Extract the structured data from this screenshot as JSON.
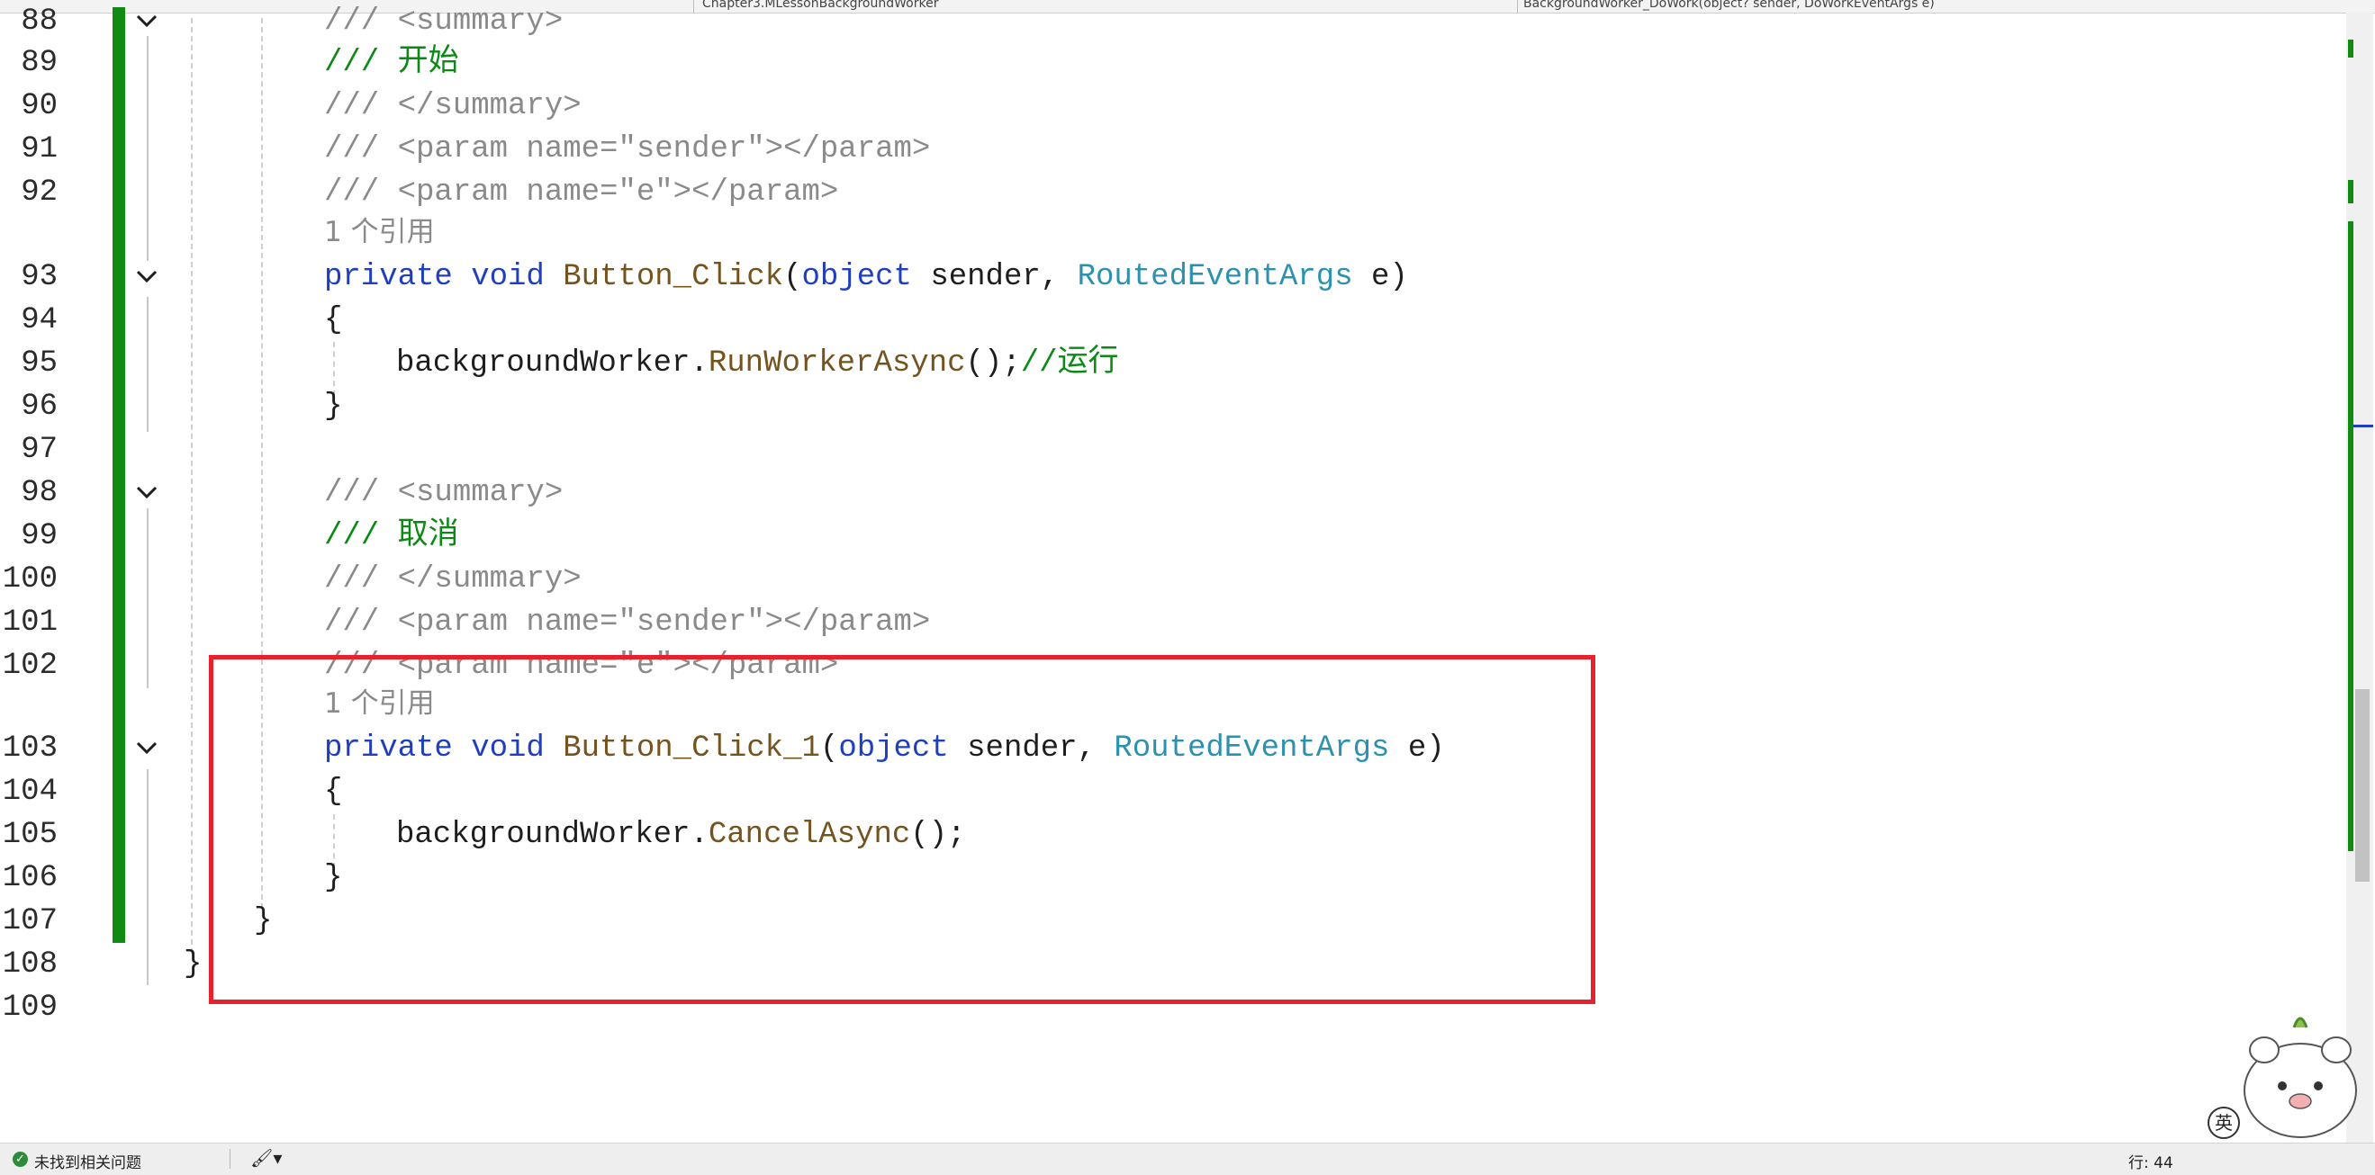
{
  "tabs": {
    "nav_left": "Chapter3.MLessonBackgroundWorker",
    "nav_right": "BackgroundWorker_DoWork(object? sender, DoWorkEventArgs e)"
  },
  "editor": {
    "lines": [
      {
        "ln": "88",
        "code": "/// <summary>"
      },
      {
        "ln": "89",
        "code": "/// 开始"
      },
      {
        "ln": "90",
        "code": "/// </summary>"
      },
      {
        "ln": "91",
        "code": "/// <param name=\"sender\"></param>"
      },
      {
        "ln": "92",
        "code": "/// <param name=\"e\"></param>"
      },
      {
        "ln": "",
        "code": "1 个引用"
      },
      {
        "ln": "93",
        "code": "private void Button_Click(object sender, RoutedEventArgs e)"
      },
      {
        "ln": "94",
        "code": "{"
      },
      {
        "ln": "95",
        "code": "backgroundWorker.RunWorkerAsync();//运行"
      },
      {
        "ln": "96",
        "code": "}"
      },
      {
        "ln": "97",
        "code": ""
      },
      {
        "ln": "98",
        "code": "/// <summary>"
      },
      {
        "ln": "99",
        "code": "/// 取消"
      },
      {
        "ln": "100",
        "code": "/// </summary>"
      },
      {
        "ln": "101",
        "code": "/// <param name=\"sender\"></param>"
      },
      {
        "ln": "102",
        "code": "/// <param name=\"e\"></param>"
      },
      {
        "ln": "",
        "code": "1 个引用"
      },
      {
        "ln": "103",
        "code": "private void Button_Click_1(object sender, RoutedEventArgs e)"
      },
      {
        "ln": "104",
        "code": "{"
      },
      {
        "ln": "105",
        "code": "backgroundWorker.CancelAsync();"
      },
      {
        "ln": "106",
        "code": "}"
      },
      {
        "ln": "107",
        "code": "}"
      },
      {
        "ln": "108",
        "code": "}"
      },
      {
        "ln": "109",
        "code": ""
      }
    ]
  },
  "status": {
    "message": "未找到相关问题",
    "position": "行: 44"
  },
  "ime": {
    "label": "英"
  },
  "colors": {
    "keyword": "#1f3fbf",
    "method": "#74531f",
    "type": "#2b91af",
    "comment": "#8a8a8a",
    "comment_text": "#0a8a14",
    "change_bar": "#108a10",
    "highlight_box": "#e8212e"
  },
  "icons": {
    "fold": "chevron-down-icon",
    "status_ok": "check-circle-icon",
    "brush": "brush-icon"
  }
}
